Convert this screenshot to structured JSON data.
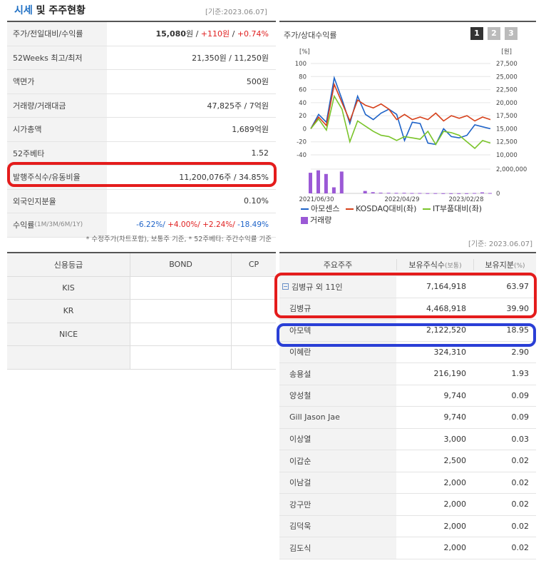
{
  "header": {
    "title_a": "시세",
    "title_b": " 및 주주현황",
    "date": "[기준:2023.06.07]"
  },
  "quote": {
    "rows": [
      {
        "label": "주가/전일대비/수익률"
      },
      {
        "label": "52Weeks 최고/최저",
        "value": "21,350원 / 11,250원"
      },
      {
        "label": "액면가",
        "value": "500원"
      },
      {
        "label": "거래량/거래대금",
        "value": "47,825주 / 7억원"
      },
      {
        "label": "시가총액",
        "value": "1,689억원"
      },
      {
        "label": "52주베타",
        "value": "1.52"
      },
      {
        "label": "발행주식수/유동비율",
        "value": "11,200,076주 / 34.85%"
      },
      {
        "label": "외국인지분율",
        "value": "0.10%"
      }
    ],
    "price": "15,080",
    "price_unit": "원 / ",
    "change": "+110원",
    "sep": " / ",
    "pct": "+0.74%",
    "returns_label": "수익률",
    "returns_sub": " (1M/3M/6M/1Y)",
    "returns": {
      "m1": "-6.22%/",
      "m3": " +4.00%/",
      "m6": " +2.24%/",
      "y1": " -18.49%"
    },
    "note": "* 수정주가(차트포함), 보통주 기준, * 52주베타: 주간수익률 기준"
  },
  "credit": {
    "headers": [
      "신용등급",
      "BOND",
      "CP"
    ],
    "agencies": [
      "KIS",
      "KR",
      "NICE"
    ]
  },
  "chart_panel": {
    "title": "주가/상대수익률",
    "buttons": [
      "1",
      "2",
      "3"
    ]
  },
  "chart_data": {
    "type": "line",
    "x": [
      "2021/06/30",
      "2022/04/29",
      "2023/02/28"
    ],
    "left_axis": {
      "unit": "[%]",
      "ticks": [
        "100",
        "80",
        "60",
        "40",
        "20",
        "0",
        "-20",
        "-40"
      ],
      "ylim": [
        -40,
        100
      ]
    },
    "right_axis": {
      "unit": "[원]",
      "ticks": [
        "27,500",
        "25,000",
        "22,500",
        "20,000",
        "17,500",
        "15,000",
        "12,500",
        "10,000"
      ],
      "ylim": [
        10000,
        27500
      ]
    },
    "volume_axis": {
      "ticks": [
        "2,000,000",
        "0"
      ]
    },
    "series": [
      {
        "name": "아모센스",
        "color": "#1e63c8",
        "values": [
          0,
          22,
          10,
          78,
          45,
          8,
          50,
          22,
          14,
          24,
          30,
          22,
          -18,
          10,
          8,
          -22,
          -24,
          0,
          -12,
          -14,
          -10,
          6,
          3,
          0
        ]
      },
      {
        "name": "KOSDAQ대비(좌)",
        "color": "#d6401a",
        "values": [
          0,
          18,
          5,
          68,
          40,
          12,
          44,
          36,
          32,
          38,
          30,
          14,
          22,
          14,
          18,
          14,
          24,
          12,
          20,
          16,
          20,
          12,
          18,
          14
        ]
      },
      {
        "name": "IT부품대비(좌)",
        "color": "#7ac42a",
        "values": [
          0,
          15,
          -2,
          50,
          30,
          -20,
          12,
          4,
          -4,
          -10,
          -12,
          -18,
          -12,
          -14,
          -16,
          -4,
          -24,
          -4,
          -6,
          -10,
          -20,
          -30,
          -18,
          -22
        ]
      },
      {
        "name": "거래량",
        "color": "#9b59d6",
        "values": [
          1700000,
          1900000,
          1600000,
          500000,
          1800000,
          0,
          0,
          200000,
          100000,
          60000,
          50000,
          40000,
          50000,
          30000,
          30000,
          20000,
          20000,
          10000,
          10000,
          10000,
          10000,
          30000,
          80000,
          30000
        ]
      }
    ]
  },
  "holders": {
    "date": "[기준: 2023.06.07]",
    "head": {
      "name": "주요주주",
      "shares": "보유주식수",
      "shares_unit": "(보통)",
      "pct": "보유지분",
      "pct_unit": "(%)"
    },
    "group": {
      "name": "김병규 외 11인",
      "shares": "7,164,918",
      "pct": "63.97"
    },
    "rows": [
      {
        "name": "김병규",
        "shares": "4,468,918",
        "pct": "39.90"
      },
      {
        "name": "아모텍",
        "shares": "2,122,520",
        "pct": "18.95"
      },
      {
        "name": "이혜란",
        "shares": "324,310",
        "pct": "2.90"
      },
      {
        "name": "송용설",
        "shares": "216,190",
        "pct": "1.93"
      },
      {
        "name": "양성철",
        "shares": "9,740",
        "pct": "0.09"
      },
      {
        "name": "Gill Jason Jae",
        "shares": "9,740",
        "pct": "0.09"
      },
      {
        "name": "이상열",
        "shares": "3,000",
        "pct": "0.03"
      },
      {
        "name": "이갑순",
        "shares": "2,500",
        "pct": "0.02"
      },
      {
        "name": "이남걸",
        "shares": "2,000",
        "pct": "0.02"
      },
      {
        "name": "강구만",
        "shares": "2,000",
        "pct": "0.02"
      },
      {
        "name": "김덕욱",
        "shares": "2,000",
        "pct": "0.02"
      },
      {
        "name": "김도식",
        "shares": "2,000",
        "pct": "0.02"
      }
    ]
  }
}
